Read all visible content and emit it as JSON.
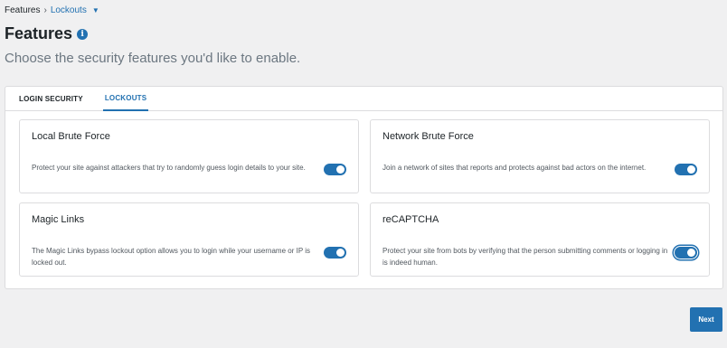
{
  "breadcrumb": {
    "root": "Features",
    "separator": "›",
    "current": "Lockouts",
    "caret_icon": "caret-down-icon"
  },
  "header": {
    "title": "Features",
    "info_icon": "info-icon",
    "info_glyph": "i",
    "subtitle": "Choose the security features you'd like to enable."
  },
  "tabs": [
    {
      "label": "LOGIN SECURITY",
      "active": false
    },
    {
      "label": "LOCKOUTS",
      "active": true
    }
  ],
  "cards": [
    {
      "title": "Local Brute Force",
      "description": "Protect your site against attackers that try to randomly guess login details to your site.",
      "enabled": true
    },
    {
      "title": "Network Brute Force",
      "description": "Join a network of sites that reports and protects against bad actors on the internet.",
      "enabled": true
    },
    {
      "title": "Magic Links",
      "description": "The Magic Links bypass lockout option allows you to login while your username or IP is locked out.",
      "enabled": true
    },
    {
      "title": "reCAPTCHA",
      "description": "Protect your site from bots by verifying that the person submitting comments or logging in is indeed human.",
      "enabled": true,
      "focused": true
    }
  ],
  "footer": {
    "next_label": "Next"
  },
  "colors": {
    "accent": "#2271b1",
    "background": "#f0f0f1",
    "panel": "#ffffff",
    "border": "#dcdcde"
  }
}
